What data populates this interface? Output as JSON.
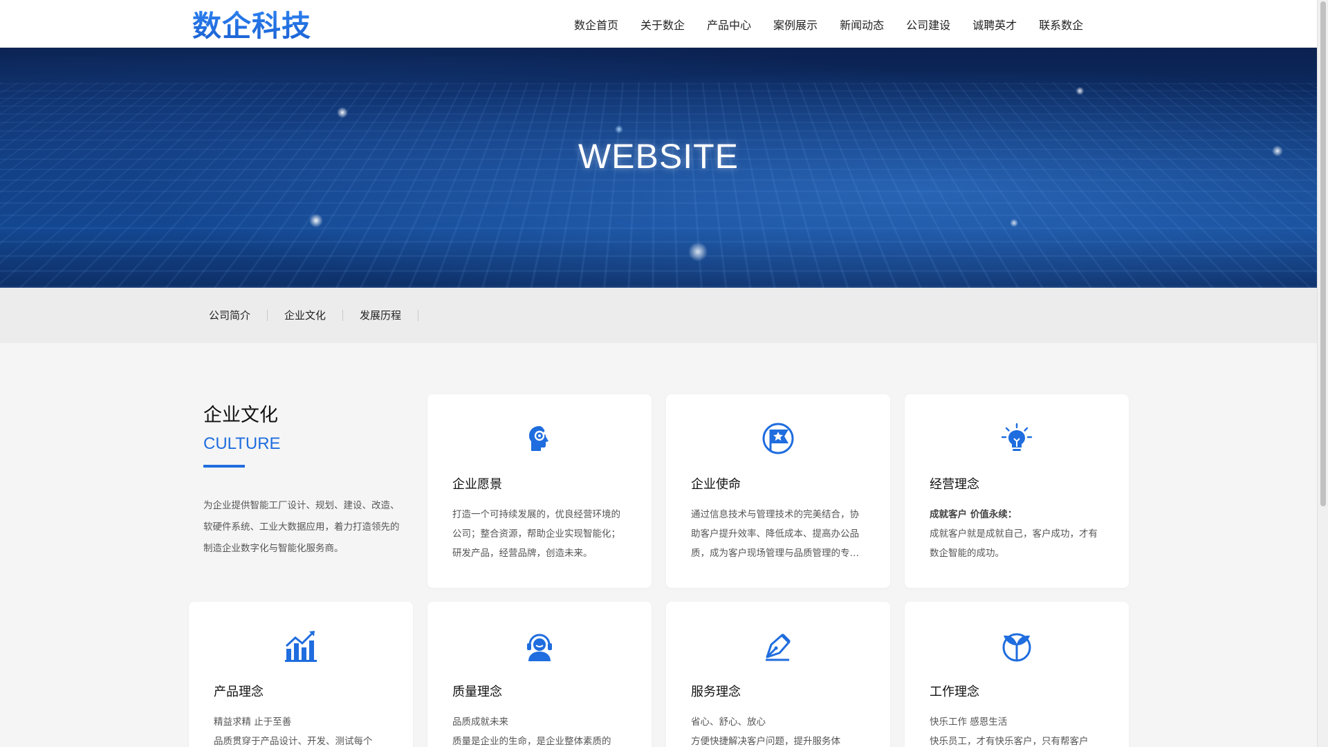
{
  "brand": {
    "logo_text": "数企科技",
    "accent": "#1f6dde"
  },
  "nav": {
    "items": [
      "数企首页",
      "关于数企",
      "产品中心",
      "案例展示",
      "新闻动态",
      "公司建设",
      "诚聘英才",
      "联系数企"
    ]
  },
  "banner": {
    "title": "WEBSITE"
  },
  "subnav": {
    "items": [
      "公司简介",
      "企业文化",
      "发展历程"
    ]
  },
  "culture": {
    "title": "企业文化",
    "subtitle": "CULTURE",
    "description": "为企业提供智能工厂设计、规划、建设、改造、软硬件系统、工业大数据应用，着力打造领先的制造企业数字化与智能化服务商。"
  },
  "cards": [
    {
      "icon": "head-gear-icon",
      "title": "企业愿景",
      "lead": "",
      "text": "打造一个可持续发展的，优良经营环境的公司；整合资源，帮助企业实现智能化；研发产品，经营品牌，创造未来。"
    },
    {
      "icon": "flag-star-icon",
      "title": "企业使命",
      "lead": "",
      "text": "通过信息技术与管理技术的完美结合，协助客户提升效率、降低成本、提高办公品质，成为客户现场管理与品质管理的专家。"
    },
    {
      "icon": "lightbulb-icon",
      "title": "经营理念",
      "lead": "成就客户 价值永续：",
      "text": "成就客户就是成就自己，客户成功，才有数企智能的成功。"
    },
    {
      "icon": "growth-chart-icon",
      "title": "产品理念",
      "lead": "精益求精 止于至善",
      "text": "品质贯穿于产品设计、开发、测试每个"
    },
    {
      "icon": "headset-person-icon",
      "title": "质量理念",
      "lead": "品质成就未来",
      "text": "质量是企业的生命，是企业整体素质的"
    },
    {
      "icon": "pen-nib-icon",
      "title": "服务理念",
      "lead": "省心、舒心、放心",
      "text": "方便快捷解决客户问题，提升服务体"
    },
    {
      "icon": "sprout-icon",
      "title": "工作理念",
      "lead": "快乐工作 感恩生活",
      "text": "快乐员工，才有快乐客户，只有帮客户"
    }
  ]
}
